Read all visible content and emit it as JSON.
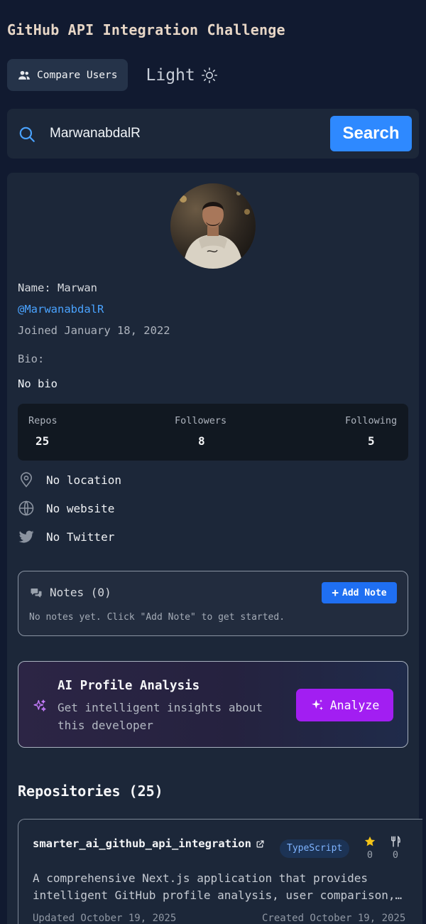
{
  "app": {
    "title": "GitHub API Integration Challenge"
  },
  "toolbar": {
    "compare_label": "Compare Users",
    "theme_label": "Light"
  },
  "search": {
    "value": "MarwanabdalR",
    "button_label": "Search"
  },
  "profile": {
    "name_line": "Name: Marwan",
    "login": "@MarwanabdalR",
    "joined": "Joined January 18, 2022",
    "bio_label": "Bio:",
    "bio": "No bio",
    "stats": {
      "repos_label": "Repos",
      "repos": "25",
      "followers_label": "Followers",
      "followers": "8",
      "following_label": "Following",
      "following": "5"
    },
    "location": "No location",
    "website": "No website",
    "twitter": "No Twitter"
  },
  "notes": {
    "title": "Notes (0)",
    "add_label": "Add Note",
    "empty": "No notes yet. Click \"Add Note\" to get started."
  },
  "ai": {
    "title": "AI Profile Analysis",
    "subtitle": "Get intelligent insights about this developer",
    "button_label": "Analyze"
  },
  "repositories": {
    "heading": "Repositories (25)",
    "items": [
      {
        "name": "smarter_ai_github_api_integration",
        "language": "TypeScript",
        "stars": "0",
        "forks": "0",
        "description_line1": "A comprehensive Next.js application that provides",
        "description_line2": "intelligent GitHub profile analysis, user comparison, and more",
        "updated": "Updated October 19, 2025",
        "created": "Created October 19, 2025"
      }
    ]
  },
  "colors": {
    "background": "#111a30",
    "card": "#1c2739",
    "accent_blue": "#2e89ff",
    "link": "#4aa3ff",
    "analyze_purple": "#a21ef2",
    "star": "#f5c518"
  },
  "icons": [
    "users-icon",
    "sun-icon",
    "search-icon",
    "location-icon",
    "globe-icon",
    "twitter-icon",
    "notes-icon",
    "plus-icon",
    "sparkles-icon",
    "external-link-icon",
    "star-icon",
    "fork-icon"
  ]
}
